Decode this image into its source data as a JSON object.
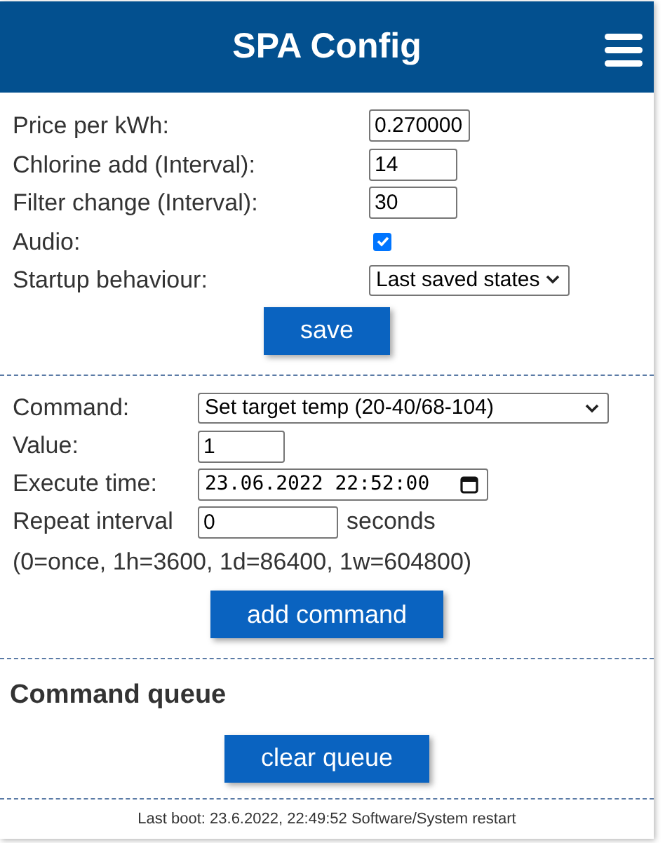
{
  "header": {
    "title": "SPA Config"
  },
  "settings": [
    {
      "kind": "text",
      "label": "Price per kWh:",
      "value": "0.270000"
    },
    {
      "kind": "text",
      "label": "Chlorine add (Interval):",
      "value": "14"
    },
    {
      "kind": "text",
      "label": "Filter change (Interval):",
      "value": "30"
    },
    {
      "kind": "checkbox",
      "label": "Audio:",
      "checked": true
    },
    {
      "kind": "select",
      "label": "Startup behaviour:",
      "value": "Last saved states"
    }
  ],
  "save_button": "save",
  "command_form": {
    "fields": [
      {
        "kind": "select",
        "label": "Command:",
        "value": "Set target temp (20-40/68-104)"
      },
      {
        "kind": "text",
        "label": "Value:",
        "value": "1"
      },
      {
        "kind": "datetime",
        "label": "Execute time:",
        "value": "23.06.2022 22:52:00"
      },
      {
        "kind": "text",
        "label": "Repeat interval",
        "value": "0",
        "unit": "seconds"
      }
    ],
    "hint": "(0=once, 1h=3600, 1d=86400, 1w=604800)",
    "button": "add command"
  },
  "command_queue": {
    "title": "Command queue",
    "button": "clear queue"
  },
  "footer": "Last boot: 23.6.2022, 22:49:52 Software/System restart"
}
